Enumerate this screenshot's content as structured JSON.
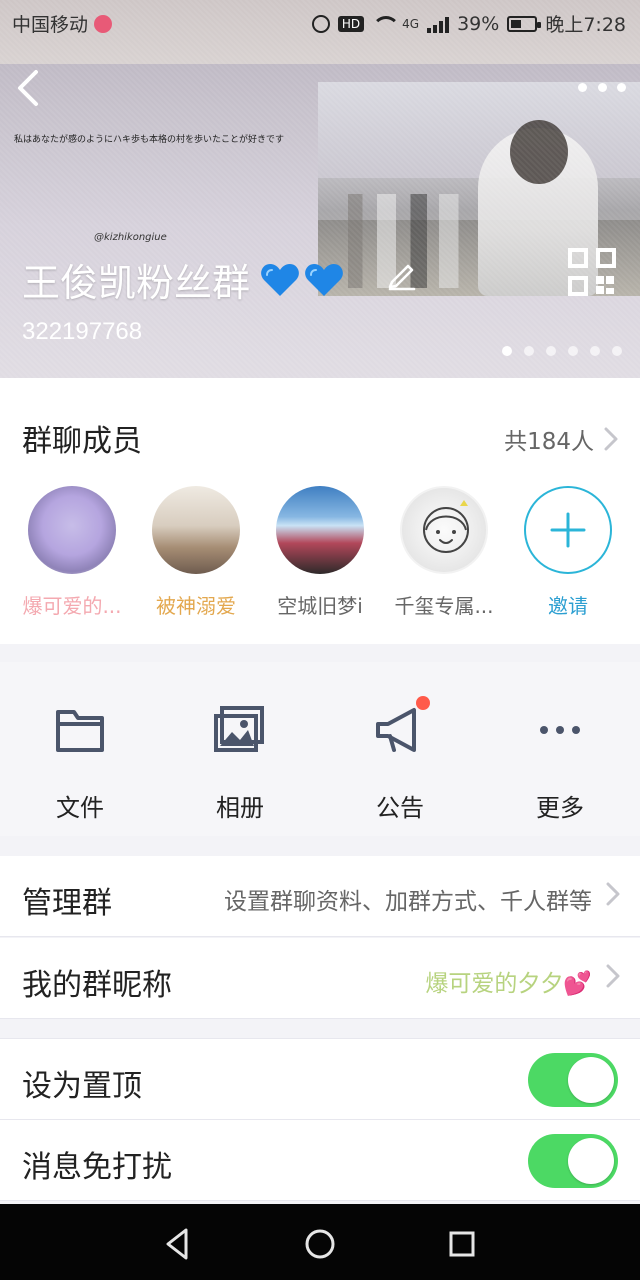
{
  "status_bar": {
    "carrier": "中国移动",
    "network": "4G",
    "battery": "39%",
    "time": "晚上7:28"
  },
  "header": {
    "overlay_text": "私はあなたが感のようにハキ歩も本格の村を歩いたことが好きです",
    "handle": "@kizhikongiue",
    "group_name": "王俊凯粉丝群",
    "group_id": "322197768",
    "pager_count": 6,
    "pager_active_index": 0
  },
  "members": {
    "title": "群聊成员",
    "count_label": "共184人",
    "items": [
      {
        "name": "爆可爱的..."
      },
      {
        "name": "被神溺爱"
      },
      {
        "name": "空城旧梦i"
      },
      {
        "name": "千玺专属..."
      },
      {
        "name": "邀请"
      }
    ]
  },
  "actions": [
    {
      "label": "文件"
    },
    {
      "label": "相册"
    },
    {
      "label": "公告"
    },
    {
      "label": "更多"
    }
  ],
  "settings": {
    "manage": {
      "title": "管理群",
      "subtitle": "设置群聊资料、加群方式、千人群等"
    },
    "nickname": {
      "title": "我的群昵称",
      "value": "爆可爱的夕夕💕"
    },
    "pin": {
      "title": "设为置顶",
      "on": true
    },
    "mute": {
      "title": "消息免打扰",
      "on": true
    }
  },
  "colors": {
    "toggle_on": "#4cd964",
    "accent_blue": "#2c9fd1",
    "badge_red": "#ff5a4a",
    "nickname_green": "#b7d37f"
  }
}
